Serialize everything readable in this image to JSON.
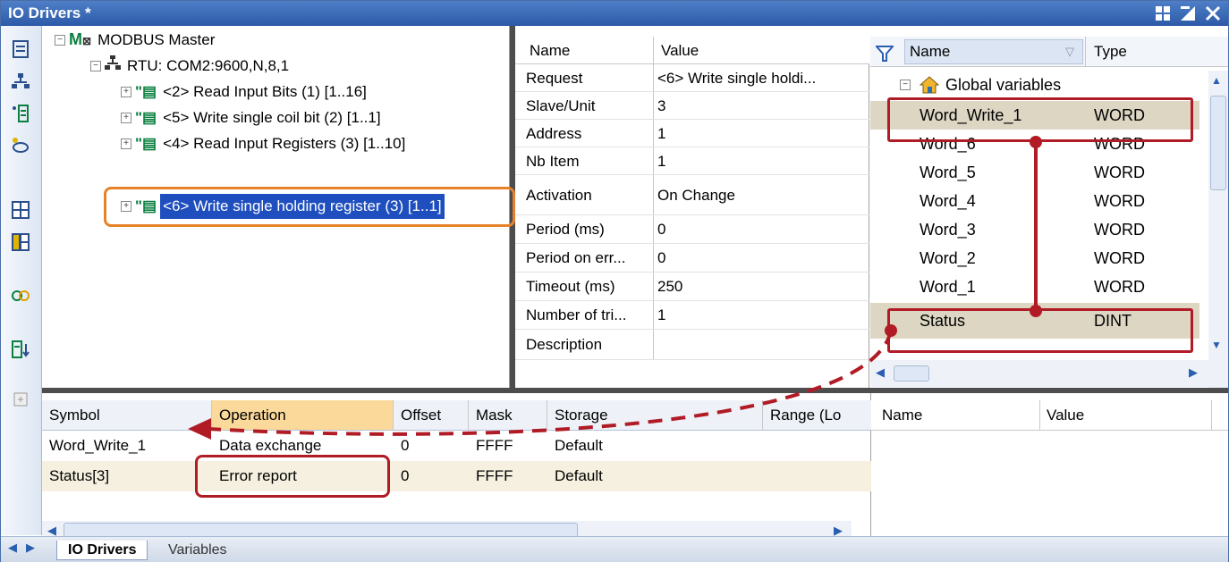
{
  "window": {
    "title": "IO Drivers *"
  },
  "tree": {
    "root": "MODBUS Master",
    "port": "RTU: COM2:9600,N,8,1",
    "requests": [
      {
        "label": "<2> Read Input Bits (1) [1..16]"
      },
      {
        "label": "<5> Write single coil bit (2) [1..1]"
      },
      {
        "label": "<4> Read Input Registers (3) [1..10]"
      },
      {
        "label": "<6> Write single holding register (3) [1..1]",
        "selected": true
      }
    ]
  },
  "properties": {
    "headers": [
      "Name",
      "Value"
    ],
    "rows": [
      {
        "name": "Request",
        "value": "<6> Write single holdi..."
      },
      {
        "name": "Slave/Unit",
        "value": "3"
      },
      {
        "name": "Address",
        "value": "1"
      },
      {
        "name": "Nb Item",
        "value": "1"
      },
      {
        "name": "Activation",
        "value": "On Change"
      },
      {
        "name": "Period (ms)",
        "value": "0"
      },
      {
        "name": "Period on err...",
        "value": "0"
      },
      {
        "name": "Timeout (ms)",
        "value": "250"
      },
      {
        "name": "Number of tri...",
        "value": "1"
      },
      {
        "name": "Description",
        "value": ""
      }
    ]
  },
  "variables": {
    "headers": [
      "Name",
      "Type"
    ],
    "group": "Global variables",
    "rows": [
      {
        "name": "Word_Write_1",
        "type": "WORD"
      },
      {
        "name": "Word_6",
        "type": "WORD"
      },
      {
        "name": "Word_5",
        "type": "WORD"
      },
      {
        "name": "Word_4",
        "type": "WORD"
      },
      {
        "name": "Word_3",
        "type": "WORD"
      },
      {
        "name": "Word_2",
        "type": "WORD"
      },
      {
        "name": "Word_1",
        "type": "WORD"
      },
      {
        "name": "Status",
        "type": "DINT"
      }
    ]
  },
  "grid": {
    "headers": [
      "Symbol",
      "Operation",
      "Offset",
      "Mask",
      "Storage",
      "Range (Lo"
    ],
    "rows": [
      {
        "symbol": "Word_Write_1",
        "operation": "Data exchange",
        "offset": "0",
        "mask": "FFFF",
        "storage": "Default"
      },
      {
        "symbol": "Status[3]",
        "operation": "Error report",
        "offset": "0",
        "mask": "FFFF",
        "storage": "Default"
      }
    ]
  },
  "watch": {
    "headers": [
      "Name",
      "Value"
    ]
  },
  "tabs": [
    "IO Drivers",
    "Variables"
  ],
  "colors": {
    "annotation_red": "#b11b26",
    "annotation_orange": "#e8822a",
    "selection": "#1f4fbf"
  }
}
